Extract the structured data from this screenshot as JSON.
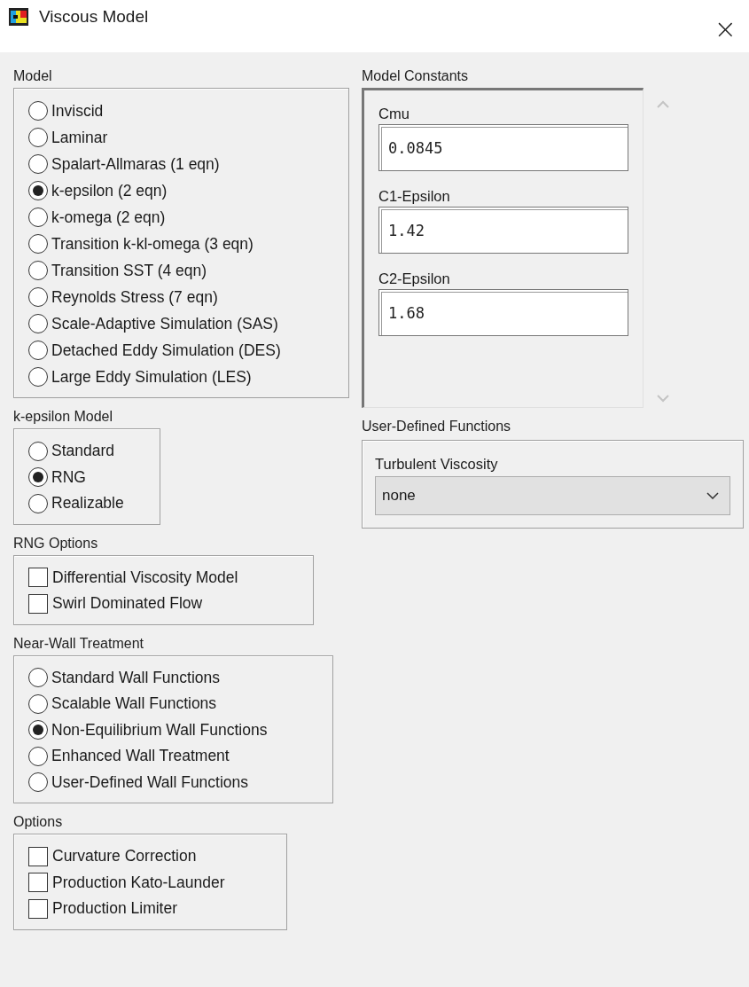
{
  "window": {
    "title": "Viscous Model",
    "close": "×"
  },
  "left_groups": [
    {
      "title": "Model",
      "kind": "radio",
      "options": [
        {
          "label": "Inviscid",
          "selected": false
        },
        {
          "label": "Laminar",
          "selected": false
        },
        {
          "label": "Spalart-Allmaras (1 eqn)",
          "selected": false
        },
        {
          "label": "k-epsilon (2 eqn)",
          "selected": true
        },
        {
          "label": "k-omega (2 eqn)",
          "selected": false
        },
        {
          "label": "Transition k-kl-omega (3 eqn)",
          "selected": false
        },
        {
          "label": "Transition SST (4 eqn)",
          "selected": false
        },
        {
          "label": "Reynolds Stress (7 eqn)",
          "selected": false
        },
        {
          "label": "Scale-Adaptive Simulation (SAS)",
          "selected": false
        },
        {
          "label": "Detached Eddy Simulation (DES)",
          "selected": false
        },
        {
          "label": "Large Eddy Simulation (LES)",
          "selected": false
        }
      ]
    },
    {
      "title": "k-epsilon Model",
      "kind": "radio",
      "options": [
        {
          "label": "Standard",
          "selected": false
        },
        {
          "label": "RNG",
          "selected": true
        },
        {
          "label": "Realizable",
          "selected": false
        }
      ]
    },
    {
      "title": "RNG Options",
      "kind": "checkbox",
      "options": [
        {
          "label": "Differential Viscosity Model",
          "checked": false
        },
        {
          "label": "Swirl Dominated Flow",
          "checked": false
        }
      ]
    },
    {
      "title": "Near-Wall Treatment",
      "kind": "radio",
      "options": [
        {
          "label": "Standard Wall Functions",
          "selected": false
        },
        {
          "label": "Scalable Wall Functions",
          "selected": false
        },
        {
          "label": "Non-Equilibrium Wall Functions",
          "selected": true
        },
        {
          "label": "Enhanced Wall Treatment",
          "selected": false
        },
        {
          "label": "User-Defined Wall Functions",
          "selected": false
        }
      ]
    },
    {
      "title": "Options",
      "kind": "checkbox",
      "options": [
        {
          "label": "Curvature Correction",
          "checked": false
        },
        {
          "label": "Production Kato-Launder",
          "checked": false
        },
        {
          "label": "Production Limiter",
          "checked": false
        }
      ]
    }
  ],
  "model_constants": {
    "title": "Model Constants",
    "fields": [
      {
        "label": "Cmu",
        "value": "0.0845"
      },
      {
        "label": "C1-Epsilon",
        "value": "1.42"
      },
      {
        "label": "C2-Epsilon",
        "value": "1.68"
      }
    ]
  },
  "user_defined_functions": {
    "title": "User-Defined Functions",
    "dropdowns": [
      {
        "label": "Turbulent Viscosity",
        "value": "none"
      }
    ]
  }
}
